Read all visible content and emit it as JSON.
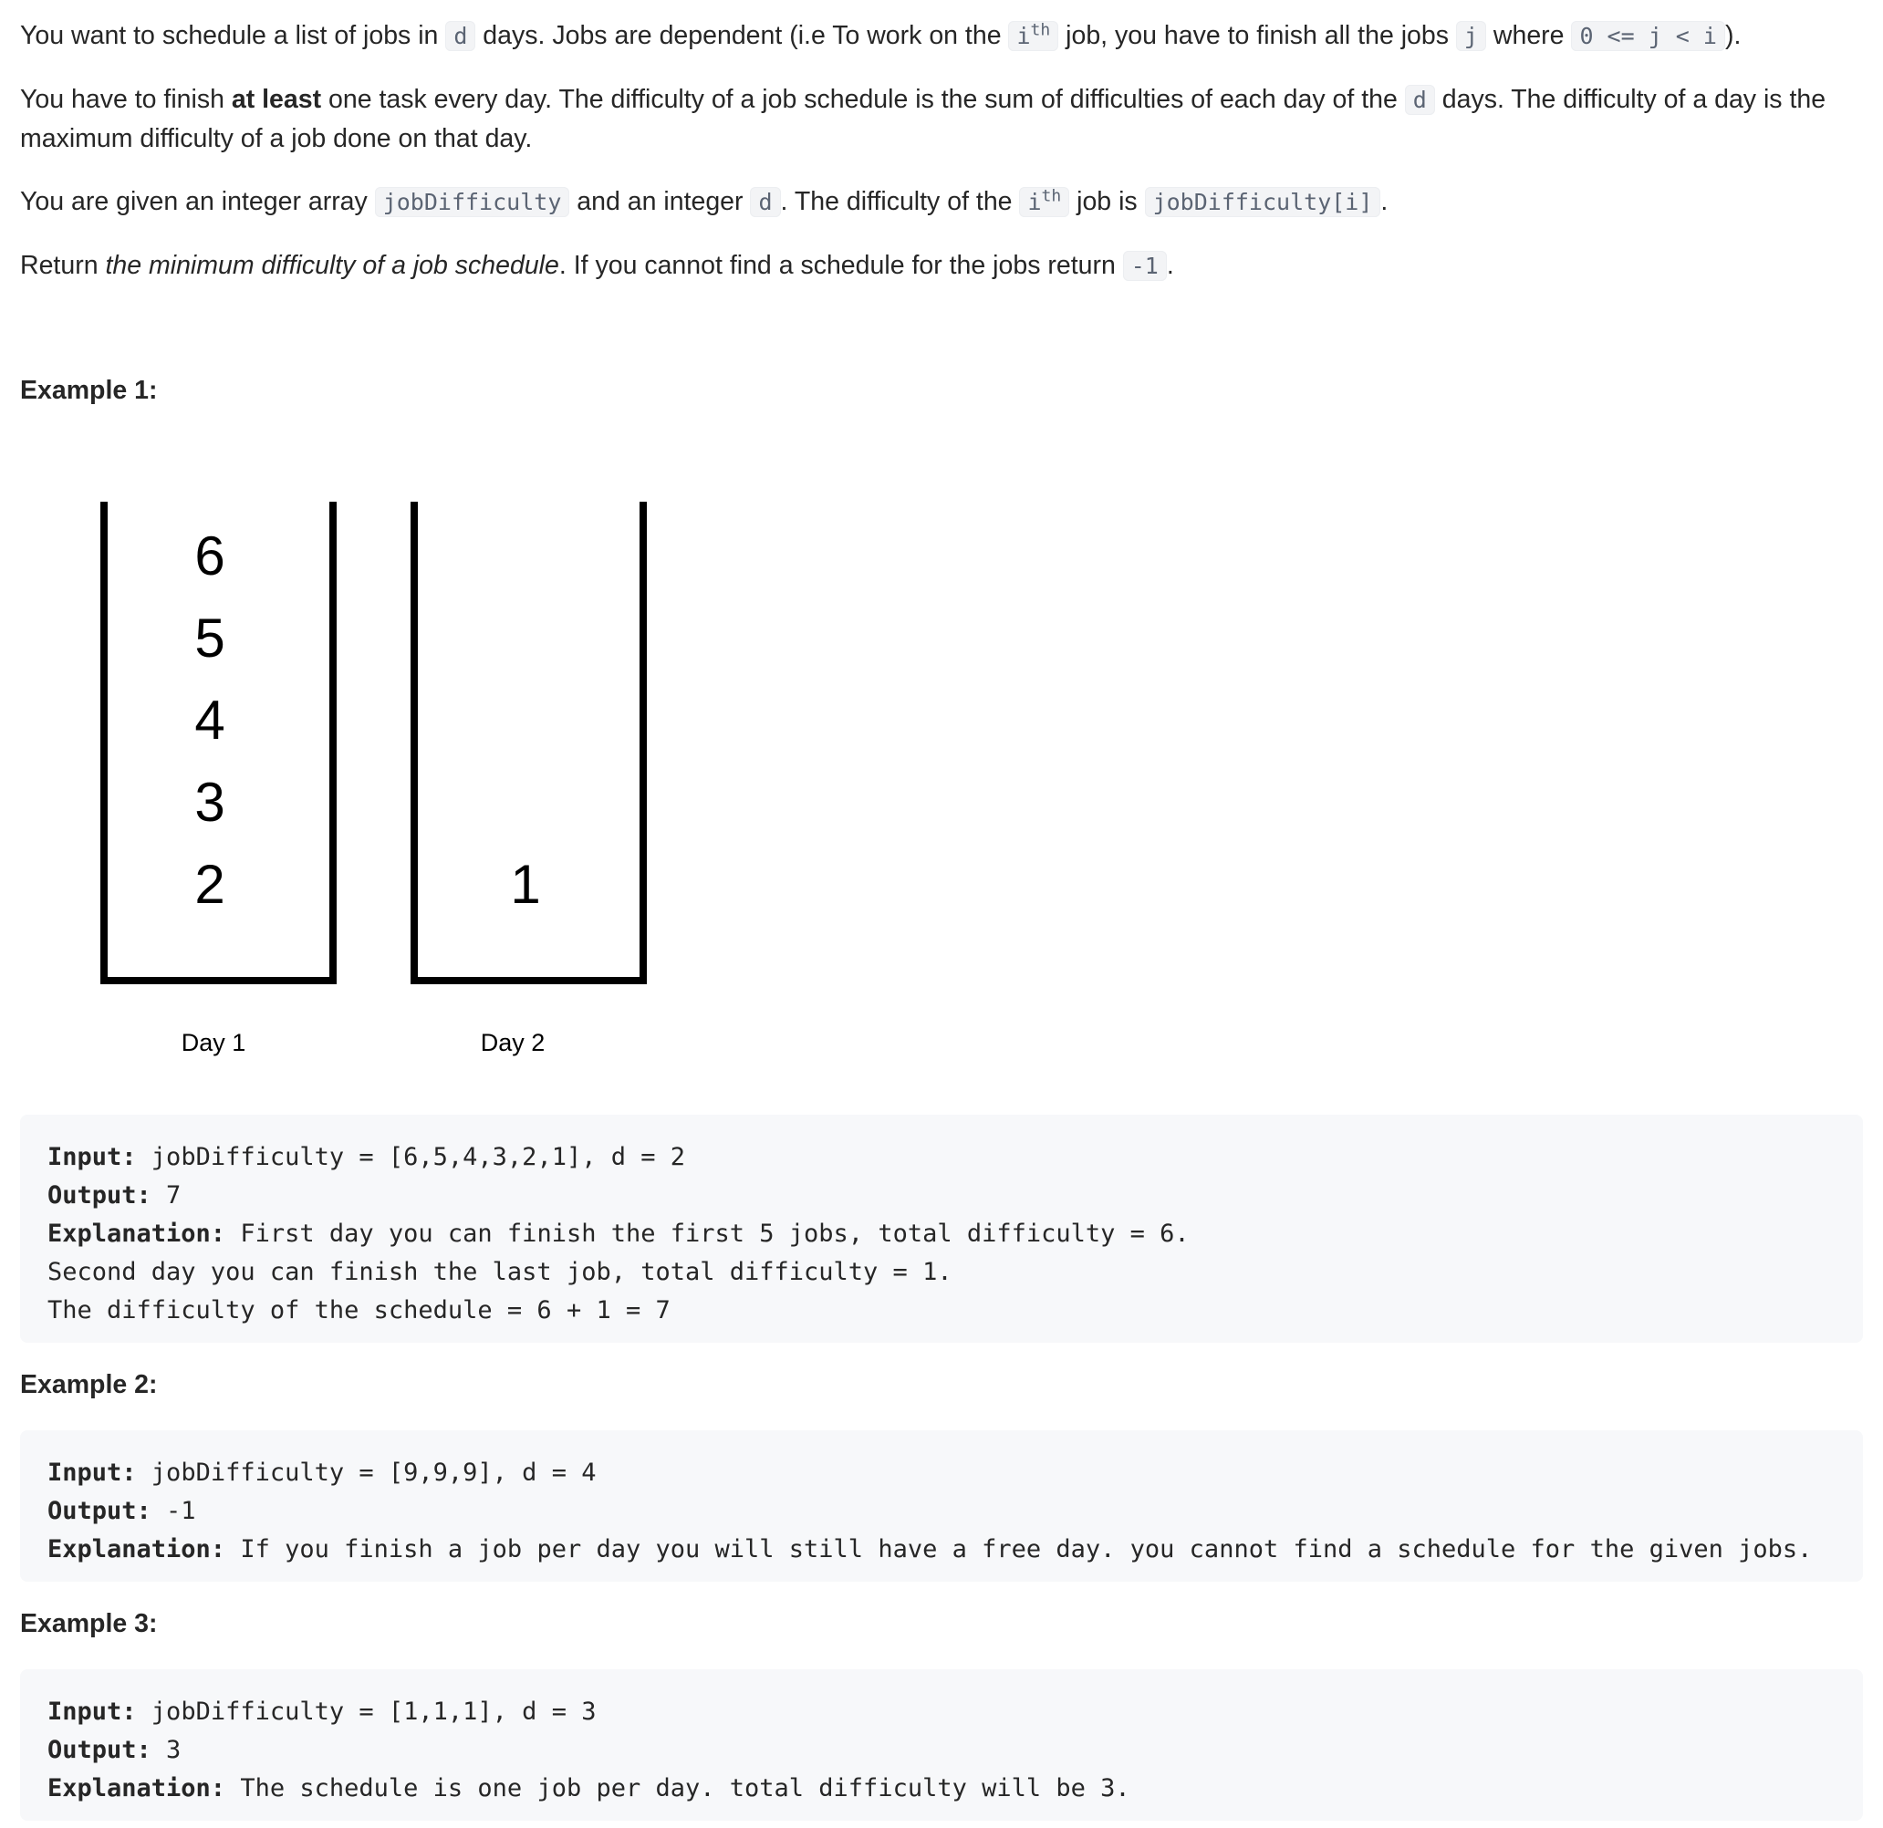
{
  "description": {
    "p1": {
      "t1": "You want to schedule a list of jobs in ",
      "c1": "d",
      "t2": " days. Jobs are dependent (i.e To work on the ",
      "c2": "i",
      "c2_sup": "th",
      "t3": " job, you have to finish all the jobs ",
      "c3": "j",
      "t4": " where ",
      "c4": "0 <= j < i",
      "t5": ")."
    },
    "p2": {
      "t1": "You have to finish ",
      "b1": "at least",
      "t2": " one task every day. The difficulty of a job schedule is the sum of difficulties of each day of the ",
      "c1": "d",
      "t3": " days. The difficulty of a day is the maximum difficulty of a job done on that day."
    },
    "p3": {
      "t1": "You are given an integer array ",
      "c1": "jobDifficulty",
      "t2": " and an integer ",
      "c2": "d",
      "t3": ". The difficulty of the ",
      "c3": "i",
      "c3_sup": "th",
      "t4": " job is ",
      "c4": "jobDifficulty[i]",
      "t5": "."
    },
    "p4": {
      "t1": "Return ",
      "i1": "the minimum difficulty of a job schedule",
      "t2": ". If you cannot find a schedule for the jobs return ",
      "c1": "-1",
      "t3": "."
    }
  },
  "figure": {
    "day1_jobs": [
      "6",
      "5",
      "4",
      "3",
      "2"
    ],
    "day2_jobs": [
      "1"
    ],
    "day1_label": "Day 1",
    "day2_label": "Day 2"
  },
  "examples": [
    {
      "title": "Example 1:",
      "input_label": "Input:",
      "input": " jobDifficulty = [6,5,4,3,2,1], d = 2",
      "output_label": "Output:",
      "output": " 7",
      "explanation_label": "Explanation:",
      "explanation": " First day you can finish the first 5 jobs, total difficulty = 6.\nSecond day you can finish the last job, total difficulty = 1.\nThe difficulty of the schedule = 6 + 1 = 7"
    },
    {
      "title": "Example 2:",
      "input_label": "Input:",
      "input": " jobDifficulty = [9,9,9], d = 4",
      "output_label": "Output:",
      "output": " -1",
      "explanation_label": "Explanation:",
      "explanation": " If you finish a job per day you will still have a free day. you cannot find a schedule for the given jobs."
    },
    {
      "title": "Example 3:",
      "input_label": "Input:",
      "input": " jobDifficulty = [1,1,1], d = 3",
      "output_label": "Output:",
      "output": " 3",
      "explanation_label": "Explanation:",
      "explanation": " The schedule is one job per day. total difficulty will be 3."
    }
  ]
}
